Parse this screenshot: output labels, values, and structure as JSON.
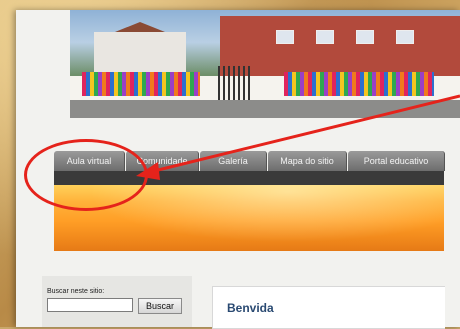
{
  "nav": {
    "tabs": [
      {
        "label": "Aula virtual"
      },
      {
        "label": "Comunidade"
      },
      {
        "label": "Galería"
      },
      {
        "label": "Mapa do sitio"
      },
      {
        "label": "Portal educativo"
      }
    ]
  },
  "search": {
    "label": "Buscar neste sitio:",
    "value": "",
    "button_label": "Buscar"
  },
  "content": {
    "title": "Benvida"
  },
  "annotation": {
    "color": "#e5231b"
  }
}
